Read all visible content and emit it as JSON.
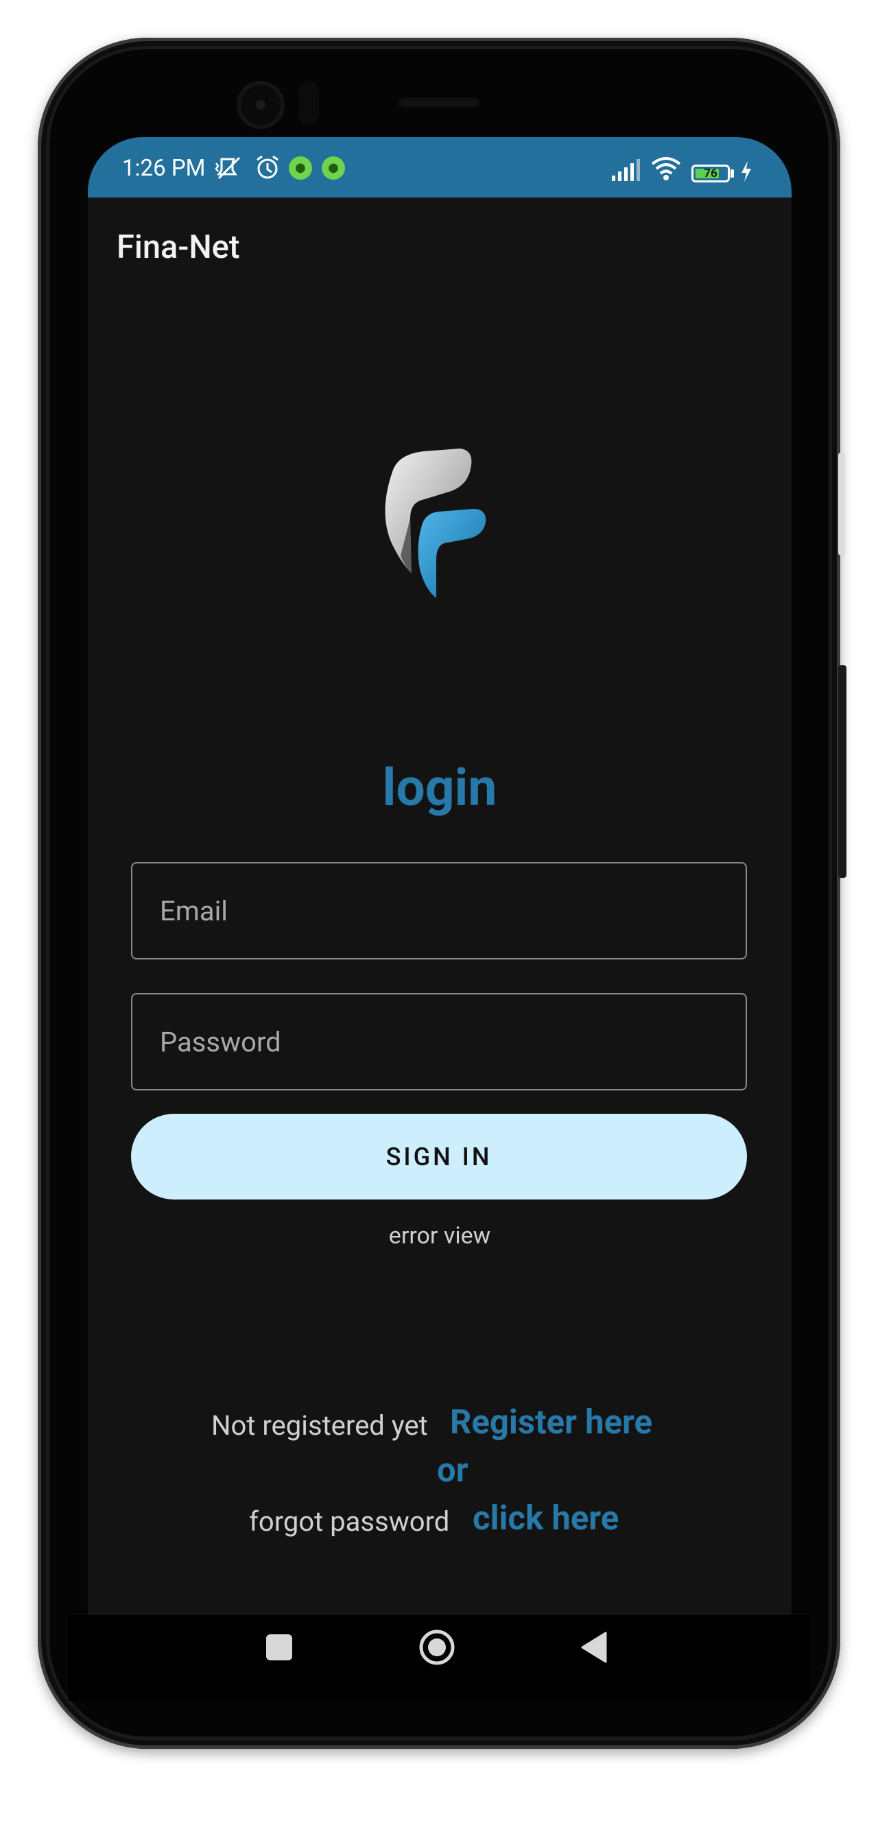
{
  "status_bar": {
    "time": "1:26 PM",
    "battery_level": "76",
    "icons": [
      "mute-vibrate-icon",
      "alarm-icon",
      "app-notification-icon",
      "app-notification-icon",
      "signal-icon",
      "wifi-icon",
      "battery-icon",
      "charging-icon"
    ],
    "color": "#23709c"
  },
  "app_bar": {
    "title": "Fina-Net"
  },
  "logo": {
    "icon": "fina-net-logo"
  },
  "login": {
    "heading": "login",
    "email_placeholder": "Email",
    "password_placeholder": "Password",
    "signin_label": "SIGN IN",
    "error_text": "error view"
  },
  "footer": {
    "not_registered_text": "Not registered yet",
    "register_link": "Register here",
    "or_text": "or",
    "forgot_text": "forgot password",
    "click_here_link": "click here"
  },
  "nav_bar": {
    "icons": [
      "recents-icon",
      "home-icon",
      "back-icon"
    ]
  },
  "colors": {
    "accent": "#2679a8",
    "button_bg": "#cdeefd",
    "background": "#131313"
  }
}
